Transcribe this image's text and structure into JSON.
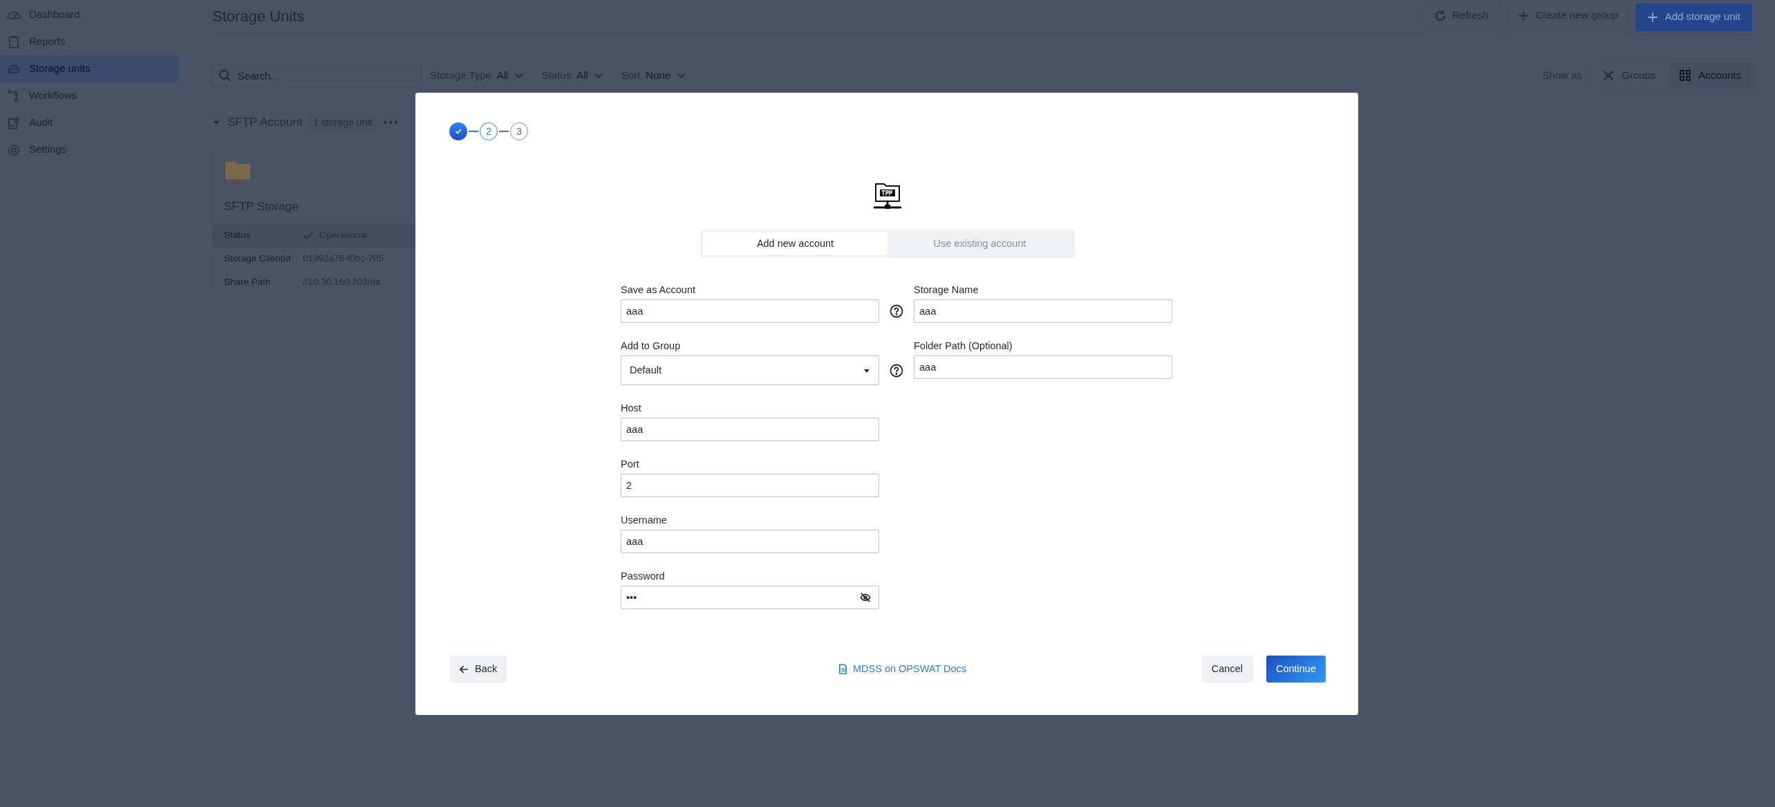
{
  "sidebar": {
    "items": [
      {
        "label": "Dashboard",
        "kind": "dashboard",
        "selected": false
      },
      {
        "label": "Reports",
        "kind": "reports",
        "selected": false
      },
      {
        "label": "Storage units",
        "kind": "storage",
        "selected": true
      },
      {
        "label": "Workflows",
        "kind": "workflows",
        "selected": false
      },
      {
        "label": "Audit",
        "kind": "audit",
        "selected": false
      },
      {
        "label": "Settings",
        "kind": "settings",
        "selected": false
      }
    ]
  },
  "page": {
    "title": "Storage Units",
    "actions": [
      {
        "label": "Refresh",
        "kind": "refresh"
      },
      {
        "label": "Create new group",
        "kind": "create"
      },
      {
        "label": "Add storage unit",
        "kind": "primary"
      }
    ]
  },
  "filters": {
    "search": {
      "placeholder": "Search..."
    },
    "dropdowns": [
      {
        "label": "Storage Type",
        "value": "All"
      },
      {
        "label": "Status",
        "value": "All"
      },
      {
        "label": "Sort",
        "value": "None"
      }
    ],
    "show_as": {
      "label": "Show as",
      "options": [
        {
          "label": "Groups",
          "kind": "groups",
          "selected": false
        },
        {
          "label": "Accounts",
          "kind": "accounts",
          "selected": true
        }
      ]
    }
  },
  "group": {
    "name": "SFTP Account",
    "count": "1 storage unit",
    "expanded": true,
    "card": {
      "title": "SFTP Storage",
      "rows": [
        {
          "label": "Status",
          "value": "Operational",
          "kind": "status"
        },
        {
          "label": "Storage ClientId",
          "value": "01992a76-f0bc-705",
          "kind": "text"
        },
        {
          "label": "Share Path",
          "value": "//10.30.160.203/da",
          "kind": "text"
        }
      ]
    }
  },
  "modal": {
    "steps": [
      {
        "kind": "done"
      },
      {
        "label": "2",
        "kind": "current"
      },
      {
        "label": "3",
        "kind": "upcoming"
      }
    ],
    "tabs": [
      {
        "label": "Add new account",
        "selected": true
      },
      {
        "label": "Use existing account",
        "selected": false
      }
    ],
    "left_fields": [
      {
        "label": "Save as Account",
        "value": "aaa",
        "kind": "text",
        "help": true
      },
      {
        "label": "Add to Group",
        "value": "Default",
        "kind": "select",
        "help": true
      },
      {
        "label": "Host",
        "value": "aaa",
        "kind": "text",
        "help": false
      },
      {
        "label": "Port",
        "value": "2",
        "kind": "text",
        "help": false
      },
      {
        "label": "Username",
        "value": "aaa",
        "kind": "text",
        "help": false
      },
      {
        "label": "Password",
        "value": "•••",
        "kind": "password",
        "help": false
      }
    ],
    "right_fields": [
      {
        "label": "Storage Name",
        "value": "aaa",
        "kind": "text"
      },
      {
        "label": "Folder Path (Optional)",
        "value": "aaa",
        "kind": "text"
      }
    ],
    "footer": {
      "back": "Back",
      "docs_link": "MDSS on OPSWAT Docs",
      "cancel": "Cancel",
      "continue": "Continue"
    }
  }
}
